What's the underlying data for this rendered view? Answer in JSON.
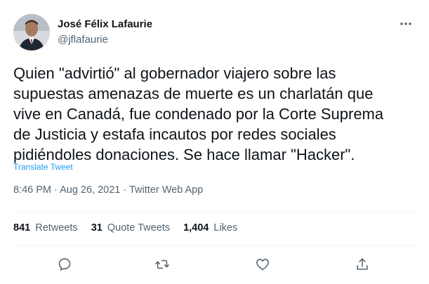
{
  "author": {
    "display_name": "José Félix Lafaurie",
    "handle": "@jflafaurie"
  },
  "tweet": {
    "lines": [
      "Quien \"advirtió\" al gobernador viajero sobre las",
      "supuestas amenazas de muerte es un charlatán que",
      "vive en Canadá, fue condenado por la Corte Suprema",
      "de Justicia y estafa incautos por redes sociales",
      "pidiéndoles donaciones. Se hace llamar \"Hacker\"."
    ],
    "translate_label": "Translate Tweet",
    "time": "8:46 PM",
    "separator": " · ",
    "date": "Aug 26, 2021",
    "source": "Twitter Web App"
  },
  "stats": {
    "retweets_count": "841",
    "retweets_label": "Retweets",
    "quotes_count": "31",
    "quotes_label": "Quote Tweets",
    "likes_count": "1,404",
    "likes_label": "Likes"
  },
  "icons": {
    "more": "more-horizontal-icon",
    "reply": "reply-icon",
    "retweet": "retweet-icon",
    "like": "heart-icon",
    "share": "share-icon"
  },
  "colors": {
    "text_primary": "#0f1419",
    "text_secondary": "#536471",
    "link": "#1d9bf0",
    "divider": "#eff3f4"
  }
}
